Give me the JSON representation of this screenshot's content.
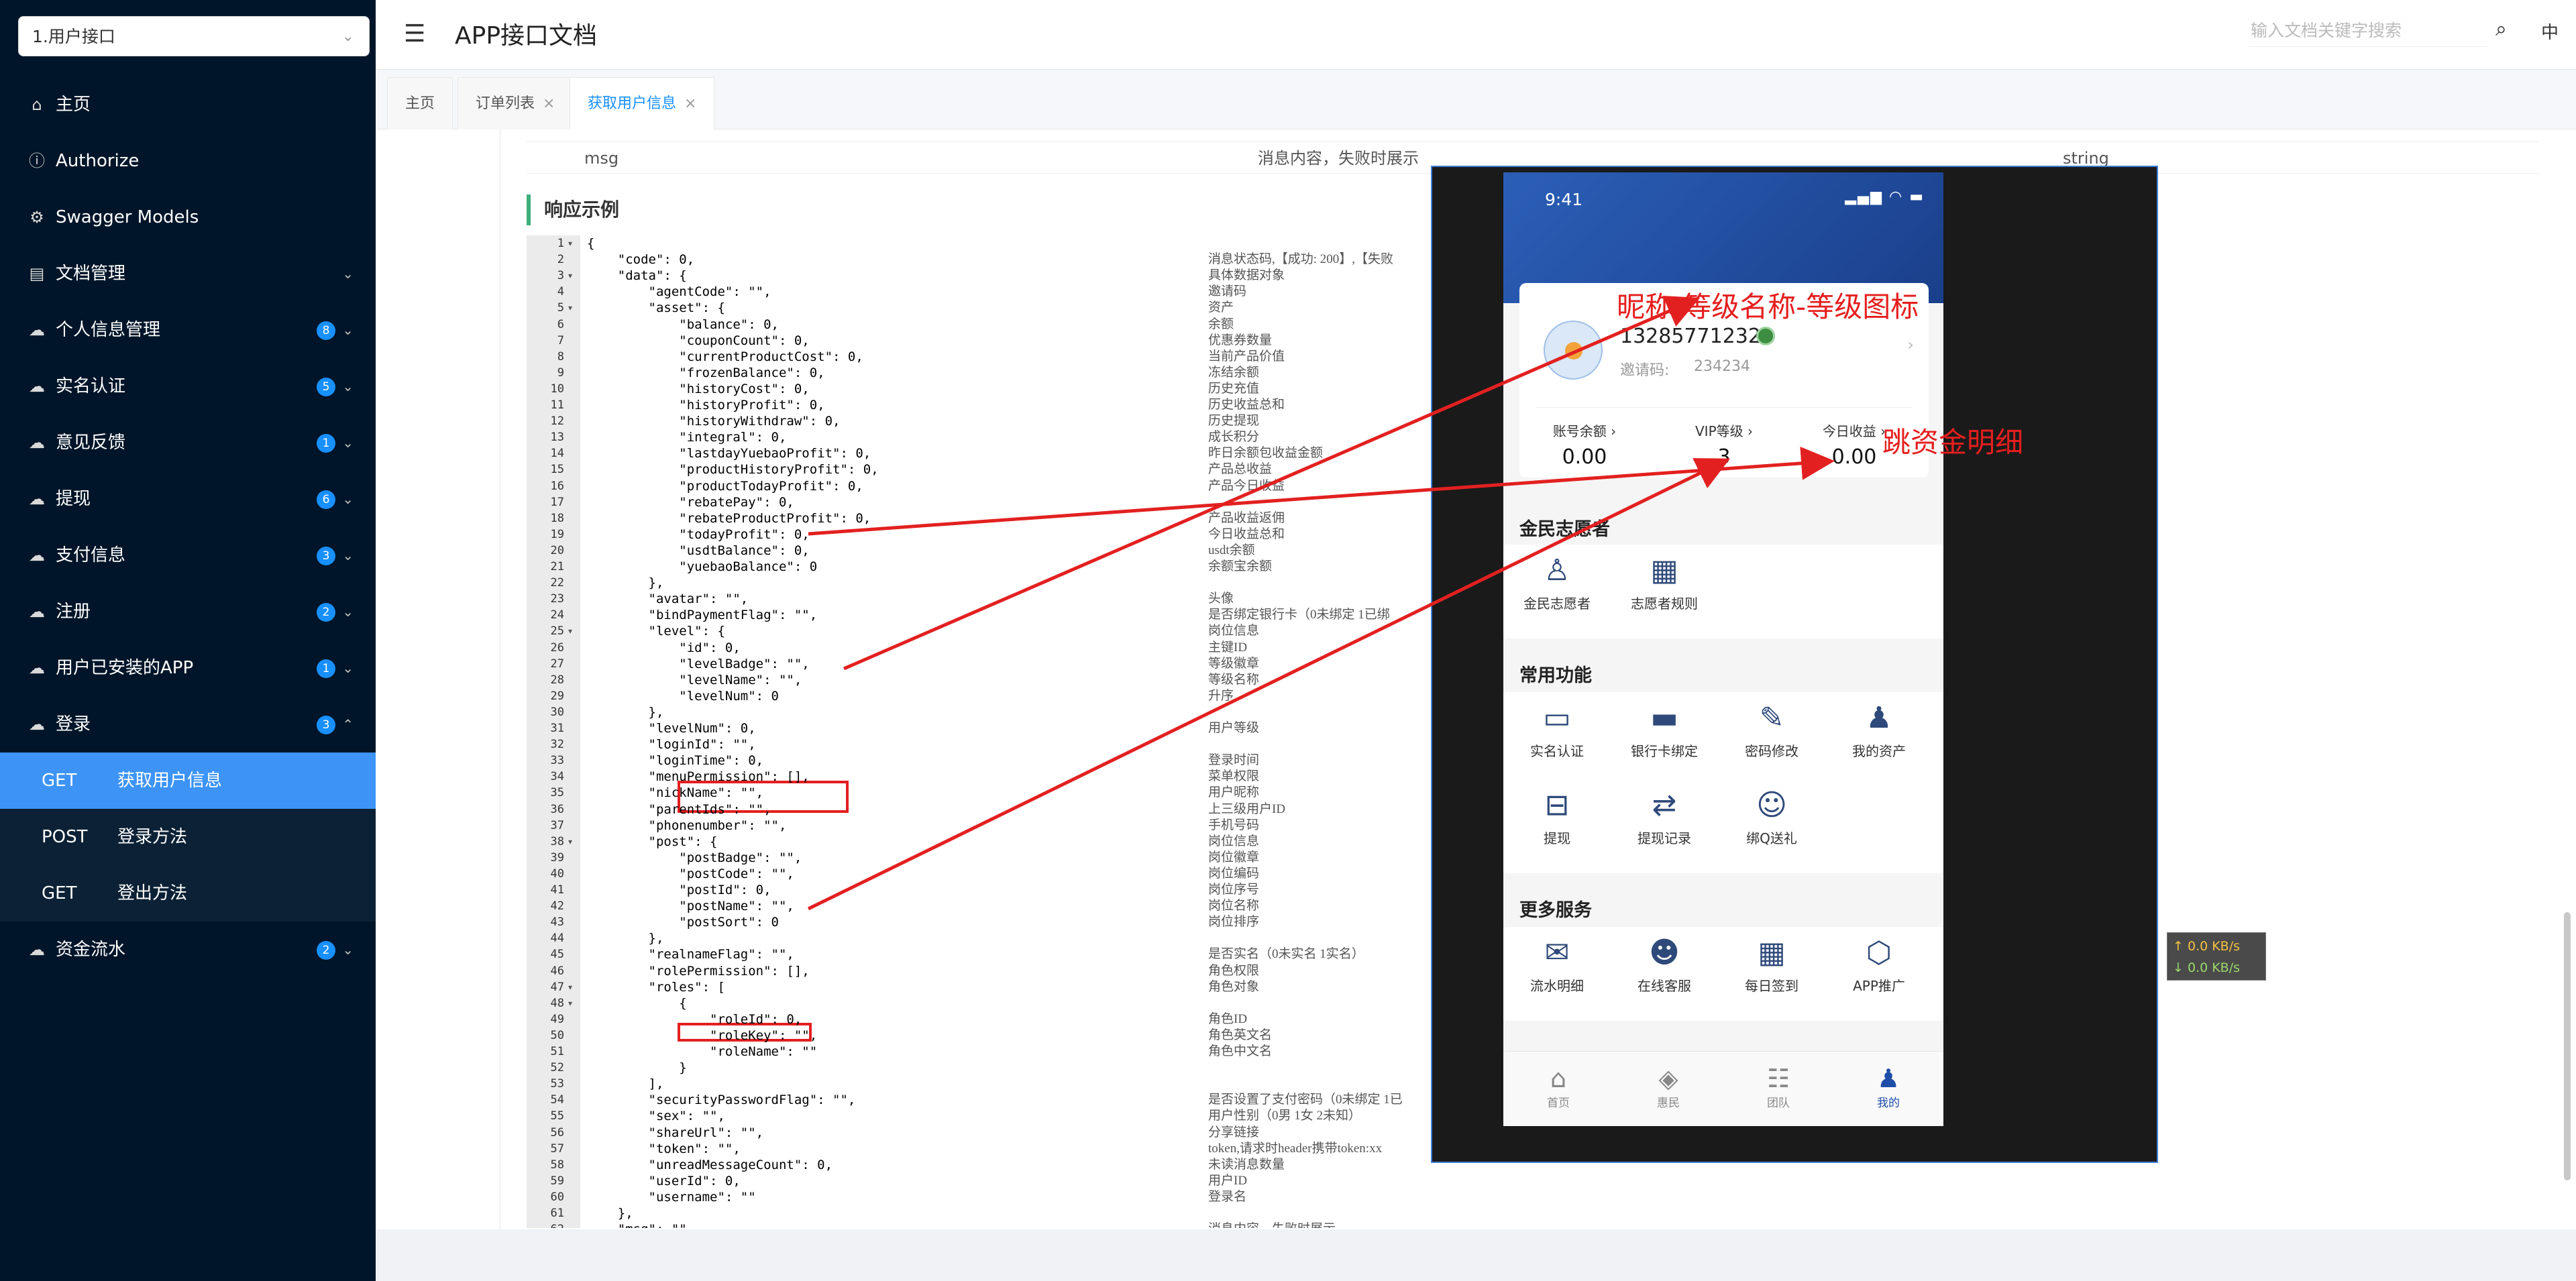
{
  "sidebar": {
    "project_select": "1.用户接口",
    "items": [
      {
        "label": "主页",
        "icon": "home-icon",
        "glyph": "⌂"
      },
      {
        "label": "Authorize",
        "icon": "info-icon",
        "glyph": "ⓘ"
      },
      {
        "label": "Swagger Models",
        "icon": "model-icon",
        "glyph": "⚙"
      },
      {
        "label": "文档管理",
        "icon": "doc-icon",
        "glyph": "▤"
      },
      {
        "label": "个人信息管理",
        "badge": "8",
        "icon": "cloud-icon",
        "glyph": "☁"
      },
      {
        "label": "实名认证",
        "badge": "5",
        "icon": "cloud-icon",
        "glyph": "☁"
      },
      {
        "label": "意见反馈",
        "badge": "1",
        "icon": "cloud-icon",
        "glyph": "☁"
      },
      {
        "label": "提现",
        "badge": "6",
        "icon": "cloud-icon",
        "glyph": "☁"
      },
      {
        "label": "支付信息",
        "badge": "3",
        "icon": "cloud-icon",
        "glyph": "☁"
      },
      {
        "label": "注册",
        "badge": "2",
        "icon": "cloud-icon",
        "glyph": "☁"
      },
      {
        "label": "用户已安装的APP",
        "badge": "1",
        "icon": "cloud-icon",
        "glyph": "☁"
      },
      {
        "label": "登录",
        "badge": "3",
        "icon": "cloud-icon",
        "glyph": "☁"
      }
    ],
    "subitems": [
      {
        "method": "GET",
        "label": "获取用户信息"
      },
      {
        "method": "POST",
        "label": "登录方法"
      },
      {
        "method": "GET",
        "label": "登出方法"
      }
    ],
    "last_item": {
      "label": "资金流水",
      "badge": "2"
    }
  },
  "header": {
    "title": "APP接口文档",
    "search_placeholder": "输入文档关键字搜索",
    "lang": "中"
  },
  "tabs": [
    {
      "label": "主页"
    },
    {
      "label": "订单列表"
    },
    {
      "label": "获取用户信息"
    }
  ],
  "content": {
    "msg_name": "msg",
    "msg_desc": "消息内容，失败时展示",
    "msg_type": "string",
    "section_title": "响应示例"
  },
  "code_lines": [
    "{",
    "    \"code\": 0,",
    "    \"data\": {",
    "        \"agentCode\": \"\",",
    "        \"asset\": {",
    "            \"balance\": 0,",
    "            \"couponCount\": 0,",
    "            \"currentProductCost\": 0,",
    "            \"frozenBalance\": 0,",
    "            \"historyCost\": 0,",
    "            \"historyProfit\": 0,",
    "            \"historyWithdraw\": 0,",
    "            \"integral\": 0,",
    "            \"lastdayYuebaoProfit\": 0,",
    "            \"productHistoryProfit\": 0,",
    "            \"productTodayProfit\": 0,",
    "            \"rebatePay\": 0,",
    "            \"rebateProductProfit\": 0,",
    "            \"todayProfit\": 0,",
    "            \"usdtBalance\": 0,",
    "            \"yuebaoBalance\": 0",
    "        },",
    "        \"avatar\": \"\",",
    "        \"bindPaymentFlag\": \"\",",
    "        \"level\": {",
    "            \"id\": 0,",
    "            \"levelBadge\": \"\",",
    "            \"levelName\": \"\",",
    "            \"levelNum\": 0",
    "        },",
    "        \"levelNum\": 0,",
    "        \"loginId\": \"\",",
    "        \"loginTime\": 0,",
    "        \"menuPermission\": [],",
    "        \"nickName\": \"\",",
    "        \"parentIds\": \"\",",
    "        \"phonenumber\": \"\",",
    "        \"post\": {",
    "            \"postBadge\": \"\",",
    "            \"postCode\": \"\",",
    "            \"postId\": 0,",
    "            \"postName\": \"\",",
    "            \"postSort\": 0",
    "        },",
    "        \"realnameFlag\": \"\",",
    "        \"rolePermission\": [],",
    "        \"roles\": [",
    "            {",
    "                \"roleId\": 0,",
    "                \"roleKey\": \"\",",
    "                \"roleName\": \"\"",
    "            }",
    "        ],",
    "        \"securityPasswordFlag\": \"\",",
    "        \"sex\": \"\",",
    "        \"shareUrl\": \"\",",
    "        \"token\": \"\",",
    "        \"unreadMessageCount\": 0,",
    "        \"userId\": 0,",
    "        \"username\": \"\"",
    "    },",
    "    \"msg\": \"\""
  ],
  "desc_lines": [
    "",
    "消息状态码,【成功: 200】,【失败",
    "具体数据对象",
    "邀请码",
    "资产",
    "余额",
    "优惠券数量",
    "当前产品价值",
    "冻结余额",
    "历史充值",
    "历史收益总和",
    "历史提现",
    "成长积分",
    "昨日余额包收益金额",
    "产品总收益",
    "产品今日收益",
    "",
    "产品收益返佣",
    "今日收益总和",
    "usdt余额",
    "余额宝余额",
    "",
    "头像",
    "是否绑定银行卡（0未绑定 1已绑",
    "岗位信息",
    "主键ID",
    "等级徽章",
    "等级名称",
    "升序",
    "",
    "用户等级",
    "",
    "登录时间",
    "菜单权限",
    "用户昵称",
    "上三级用户ID",
    "手机号码",
    "岗位信息",
    "岗位徽章",
    "岗位编码",
    "岗位序号",
    "岗位名称",
    "岗位排序",
    "",
    "是否实名（0未实名 1实名）",
    "角色权限",
    "角色对象",
    "",
    "角色ID",
    "角色英文名",
    "角色中文名",
    "",
    "",
    "是否设置了支付密码（0未绑定 1已",
    "用户性别（0男 1女 2未知）",
    "分享链接",
    "token,请求时header携带token:xx",
    "未读消息数量",
    "用户ID",
    "登录名",
    "",
    "消息内容，失败时展示"
  ],
  "phone": {
    "time": "9:41",
    "username": "13285771232",
    "invite_label": "邀请码:",
    "invite_code": "234234",
    "stats": [
      {
        "label": "账号余额 ›",
        "value": "0.00"
      },
      {
        "label": "VIP等级 ›",
        "value": "3"
      },
      {
        "label": "今日收益 ›",
        "value": "0.00"
      }
    ],
    "section_volunteer": "金民志愿者",
    "volunteer_items": [
      {
        "label": "金民志愿者",
        "glyph": "♙"
      },
      {
        "label": "志愿者规则",
        "glyph": "▦"
      }
    ],
    "section_common": "常用功能",
    "common_items": [
      {
        "label": "实名认证",
        "glyph": "▭"
      },
      {
        "label": "银行卡绑定",
        "glyph": "▬"
      },
      {
        "label": "密码修改",
        "glyph": "✎"
      },
      {
        "label": "我的资产",
        "glyph": "♟"
      },
      {
        "label": "提现",
        "glyph": "⊟"
      },
      {
        "label": "提现记录",
        "glyph": "⇄"
      },
      {
        "label": "绑Q送礼",
        "glyph": "☺"
      }
    ],
    "section_more": "更多服务",
    "more_items": [
      {
        "label": "流水明细",
        "glyph": "✉"
      },
      {
        "label": "在线客服",
        "glyph": "☻"
      },
      {
        "label": "每日签到",
        "glyph": "▦"
      },
      {
        "label": "APP推广",
        "glyph": "⬡"
      }
    ],
    "nav": [
      {
        "label": "首页",
        "glyph": "⌂"
      },
      {
        "label": "惠民",
        "glyph": "◈"
      },
      {
        "label": "团队",
        "glyph": "☷"
      },
      {
        "label": "我的",
        "glyph": "♟"
      }
    ]
  },
  "annotations": {
    "nickname_level": "昵称-等级名称-等级图标",
    "jump_detail": "跳资金明细"
  },
  "speed": {
    "up": "↑ 0.0 KB/s",
    "down": "↓ 0.0 KB/s"
  }
}
